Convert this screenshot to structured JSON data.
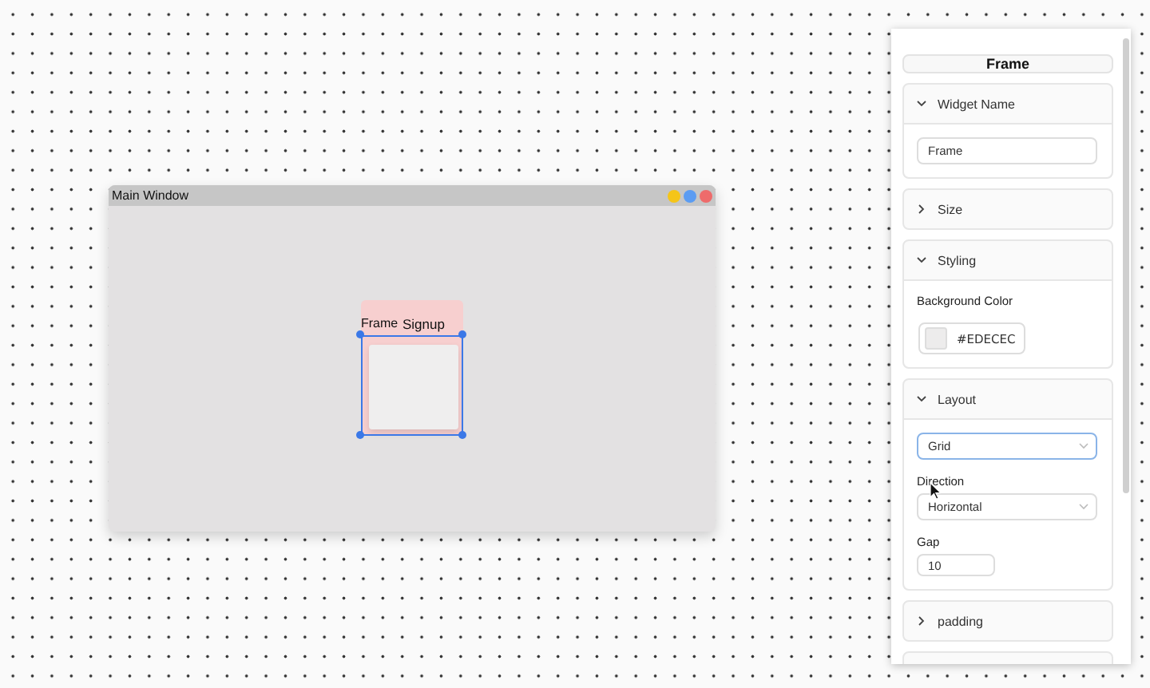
{
  "canvas": {
    "window": {
      "title": "Main Window",
      "frame": {
        "label": "Frame",
        "child_label": "Signup",
        "selected": true
      }
    }
  },
  "panel": {
    "title": "Frame",
    "sections": [
      {
        "title": "Widget Name",
        "expanded": true,
        "fields": [
          {
            "kind": "text",
            "value": "Frame"
          }
        ]
      },
      {
        "title": "Size",
        "expanded": false
      },
      {
        "title": "Styling",
        "expanded": true,
        "fields": [
          {
            "kind": "color",
            "label": "Background Color",
            "value": "#EDECEC"
          }
        ]
      },
      {
        "title": "Layout",
        "expanded": true,
        "fields": [
          {
            "kind": "select",
            "value": "Grid",
            "focused": true
          },
          {
            "kind": "select",
            "label": "Direction",
            "value": "Horizontal",
            "focused": false
          },
          {
            "kind": "number",
            "label": "Gap",
            "value": "10"
          }
        ]
      },
      {
        "title": "padding",
        "expanded": false
      },
      {
        "expanded": false
      }
    ]
  }
}
